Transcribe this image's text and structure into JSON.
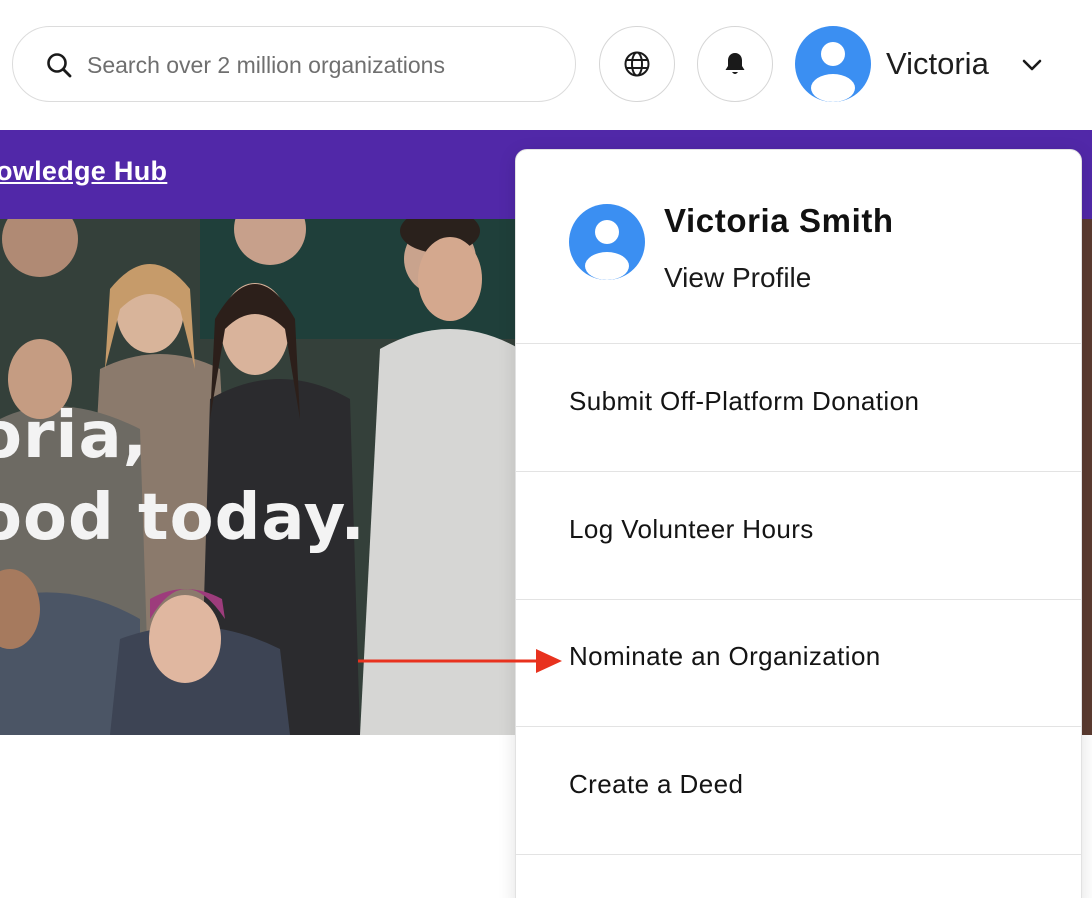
{
  "header": {
    "search": {
      "placeholder": "Search over 2 million organizations",
      "icon": "search-icon"
    },
    "globe_icon": "globe-icon",
    "bell_icon": "bell-icon",
    "user": {
      "name": "Victoria",
      "icon": "chevron-down-icon"
    }
  },
  "banner": {
    "link": "owledge Hub",
    "color": "#5128a8"
  },
  "hero": {
    "line1": "oria,",
    "line2": "ood today."
  },
  "dropdown": {
    "profile": {
      "name": "Victoria Smith",
      "link": "View Profile"
    },
    "items": [
      {
        "label": "Submit Off-Platform Donation"
      },
      {
        "label": "Log Volunteer Hours"
      },
      {
        "label": "Nominate an Organization"
      },
      {
        "label": "Create a Deed"
      }
    ]
  },
  "colors": {
    "avatar": "#3b8ff2",
    "annotation_arrow": "#e8321e"
  }
}
